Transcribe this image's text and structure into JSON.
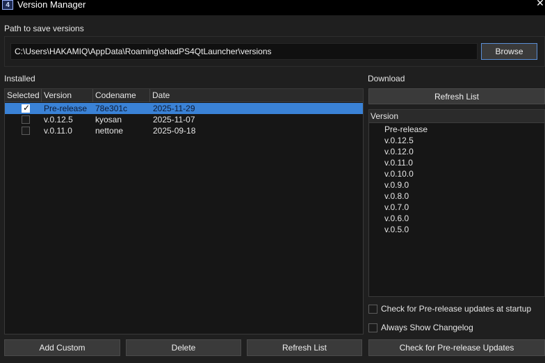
{
  "window": {
    "title": "Version Manager",
    "icon_text": "4",
    "close_glyph": "✕"
  },
  "path": {
    "label": "Path to save versions",
    "value": "C:\\Users\\HAKAMIQ\\AppData\\Roaming\\shadPS4QtLauncher\\versions",
    "browse_label": "Browse"
  },
  "installed": {
    "label": "Installed",
    "columns": [
      "Selected",
      "Version",
      "Codename",
      "Date"
    ],
    "rows": [
      {
        "checked": true,
        "version": "Pre-release",
        "codename": "78e301c",
        "date": "2025-11-29"
      },
      {
        "checked": false,
        "version": "v.0.12.5",
        "codename": "kyosan",
        "date": "2025-11-07"
      },
      {
        "checked": false,
        "version": "v.0.11.0",
        "codename": "nettone",
        "date": "2025-09-18"
      }
    ]
  },
  "download": {
    "label": "Download",
    "refresh_label": "Refresh List",
    "list_header": "Version",
    "versions": [
      "Pre-release",
      "v.0.12.5",
      "v.0.12.0",
      "v.0.11.0",
      "v.0.10.0",
      "v.0.9.0",
      "v.0.8.0",
      "v.0.7.0",
      "v.0.6.0",
      "v.0.5.0"
    ],
    "options": [
      {
        "label": "Check for Pre-release updates at startup",
        "checked": false
      },
      {
        "label": "Always Show Changelog",
        "checked": false
      }
    ]
  },
  "bottom_buttons": {
    "add_custom": "Add Custom",
    "delete": "Delete",
    "refresh_list": "Refresh List",
    "check_prerelease": "Check for Pre-release Updates"
  },
  "colors": {
    "selection": "#3a82d6",
    "focus_border": "#5b8fd6",
    "background": "#1f1f1f"
  }
}
